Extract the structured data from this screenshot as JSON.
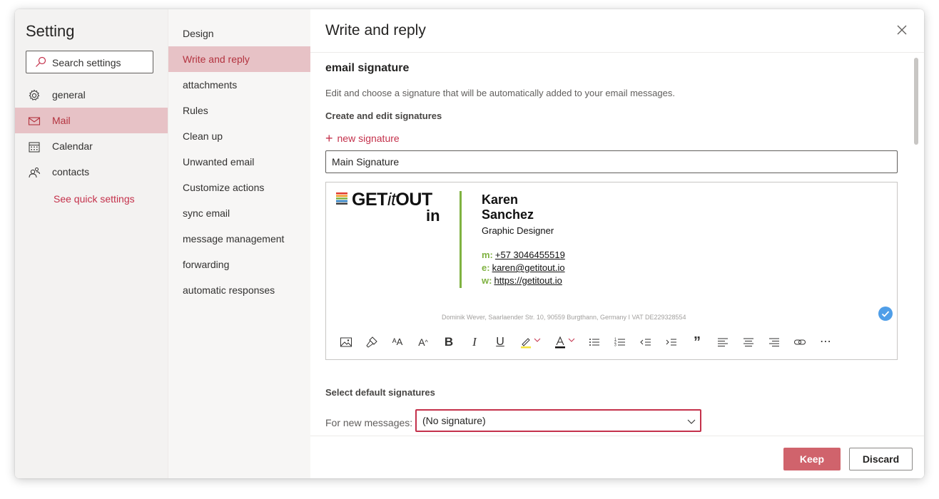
{
  "settings": {
    "title": "Setting",
    "search_placeholder": "Search settings",
    "nav": [
      {
        "label": "general",
        "icon": "gear-icon"
      },
      {
        "label": "Mail",
        "icon": "mail-icon",
        "active": true
      },
      {
        "label": "Calendar",
        "icon": "calendar-icon"
      },
      {
        "label": "contacts",
        "icon": "people-icon"
      }
    ],
    "quick_settings": "See quick settings"
  },
  "mail_nav": {
    "items": [
      "Design",
      "Write and reply",
      "attachments",
      "Rules",
      "Clean up",
      "Unwanted email",
      "Customize actions",
      "sync email",
      "message management",
      "forwarding",
      "automatic responses"
    ],
    "active": "Write and reply"
  },
  "panel": {
    "title": "Write and reply",
    "section_title": "email signature",
    "description": "Edit and choose a signature that will be automatically added to your email messages.",
    "create_edit": "Create and edit signatures",
    "new_signature": "new signature",
    "signature_name": "Main Signature",
    "signature": {
      "logo": {
        "part1": "GET",
        "part2": "it",
        "part3": "OUT",
        "line2": "in"
      },
      "name": "Karen Sanchez",
      "role": "Graphic Designer",
      "rows": [
        {
          "key": "m:",
          "value": "+57 3046455519"
        },
        {
          "key": "e:",
          "value": "karen@getitout.io"
        },
        {
          "key": "w:",
          "value": "https://getitout.io"
        }
      ],
      "footer": "Dominik Wever, Saarlaender Str. 10, 90559 Burgthann, Germany I VAT DE229328554",
      "accent_color": "#7fb241"
    },
    "toolbar": {
      "bold": "B",
      "italic": "I",
      "underline": "U",
      "quote": "”",
      "more": "⋯"
    },
    "default_title": "Select default signatures",
    "new_messages_label": "For new messages:",
    "new_messages_value": "(No signature)",
    "keep": "Keep",
    "discard": "Discard"
  },
  "colors": {
    "accent": "#c4314b",
    "active_bg": "#e7c2c6",
    "keep_bg": "#d0636c"
  }
}
